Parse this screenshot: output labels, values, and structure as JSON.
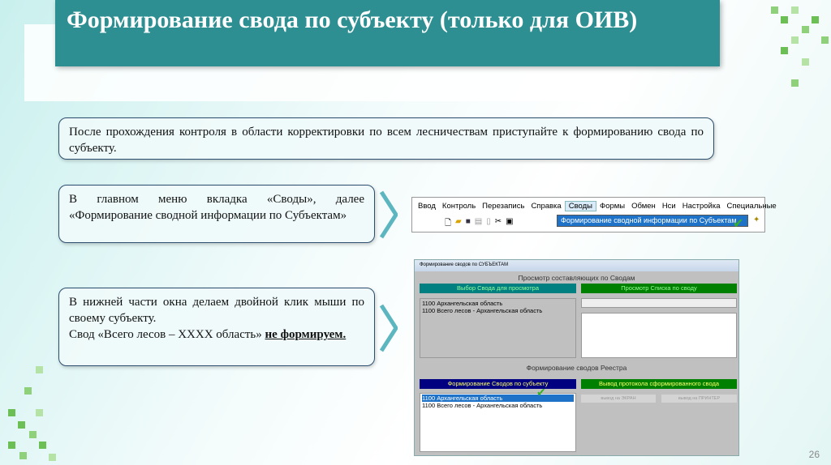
{
  "slide": {
    "title": "Формирование свода по субъекту (только для ОИВ)",
    "page_number": "26"
  },
  "boxes": [
    {
      "text": "После прохождения контроля в области корректировки по всем лесничествам приступайте к формированию свода по субъекту."
    },
    {
      "text": "В главном меню вкладка «Своды», далее «Формирование сводной информации по Субъектам»"
    },
    {
      "text_main": "В нижней части окна делаем двойной клик мыши по своему субъекту.",
      "text_note": "Свод «Всего лесов – XXXX область»",
      "text_bold": "не формируем."
    }
  ],
  "menu": {
    "items": [
      "Ввод",
      "Контроль",
      "Перезапись",
      "Справка",
      "Своды",
      "Формы",
      "Обмен",
      "Нси",
      "Настройка",
      "Специальные"
    ],
    "dropdown_item": "Формирование сводной информации по Субъектам"
  },
  "window": {
    "title": "Формирование сводов по СУБЪЕКТАМ",
    "section1": "Просмотр составляющих по Сводам",
    "header_select": "Выбор Свода для просмотра",
    "header_view": "Просмотр Списка по своду",
    "list1": [
      "1100  Архангельская область",
      "1100  Всего лесов - Архангельская область"
    ],
    "section2": "Формирование сводов Реестра",
    "header_form": "Формирование Сводов по субъекту",
    "header_output": "Вывод протокола сформированного свода",
    "list2": [
      "1100  Архангельская область",
      "1100  Всего лесов - Архангельская область"
    ],
    "btn_screen": "вывод на ЭКРАН",
    "btn_printer": "вывод на ПРИНТЕР"
  },
  "colors": {
    "title_bg": "#2e8f92",
    "teal_header": "#008080",
    "green_header": "#008000",
    "navy_header": "#000080",
    "selection": "#1e73c9"
  }
}
